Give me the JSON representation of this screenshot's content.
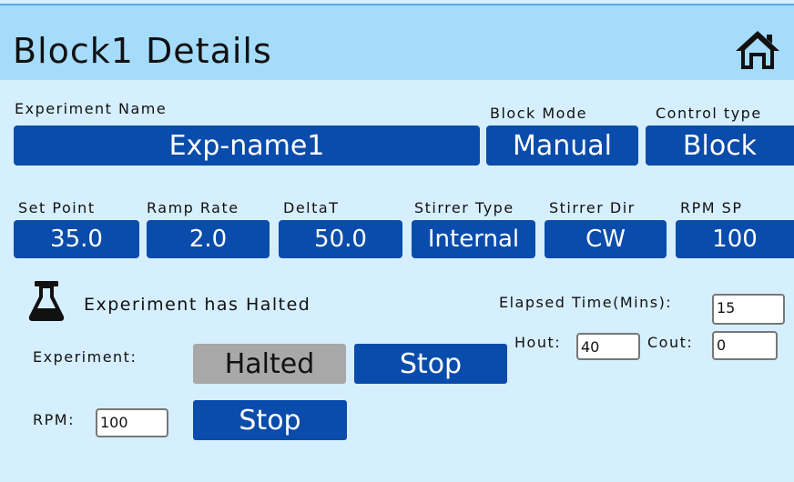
{
  "header": {
    "title": "Block1 Details",
    "home_icon": "home-icon"
  },
  "experiment_name": {
    "label": "Experiment Name",
    "value": "Exp-name1"
  },
  "block_mode": {
    "label": "Block Mode",
    "value": "Manual"
  },
  "control_type": {
    "label": "Control type",
    "value": "Block"
  },
  "params": [
    {
      "label": "Set Point",
      "value": "35.0"
    },
    {
      "label": "Ramp Rate",
      "value": "2.0"
    },
    {
      "label": "DeltaT",
      "value": "50.0"
    },
    {
      "label": "Stirrer Type",
      "value": "Internal"
    },
    {
      "label": "Stirrer Dir",
      "value": "CW"
    },
    {
      "label": "RPM SP",
      "value": "100"
    }
  ],
  "status": {
    "icon": "flask-icon",
    "text": "Experiment has Halted"
  },
  "experiment_row": {
    "label": "Experiment:",
    "state": "Halted",
    "stop_label": "Stop"
  },
  "rpm_row": {
    "label": "RPM:",
    "value": "100",
    "stop_label": "Stop"
  },
  "elapsed": {
    "label": "Elapsed Time(Mins):",
    "value": "15"
  },
  "hout": {
    "label": "Hout:",
    "value": "40"
  },
  "cout": {
    "label": "Cout:",
    "value": "0"
  },
  "colors": {
    "background": "#d6efff",
    "header": "#a6dcfb",
    "field": "#0a4cab",
    "halted": "#a8a8a8"
  }
}
